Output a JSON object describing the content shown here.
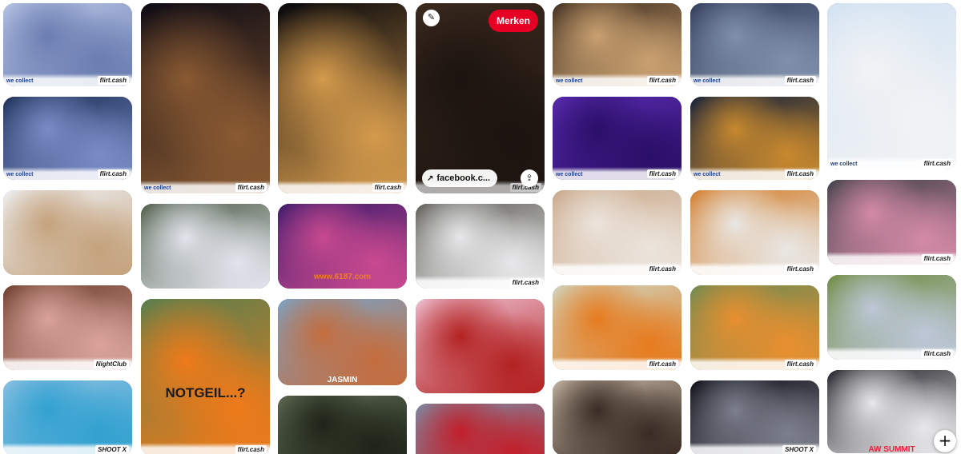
{
  "page": {
    "title": ""
  },
  "hover_actions": {
    "save_label": "Merken",
    "link_label": "facebook.c...",
    "link_arrow": "↗",
    "edit_icon": "pencil-icon",
    "share_icon": "share-icon"
  },
  "fab": {
    "label": "+",
    "icon": "plus-icon"
  },
  "watermarks": {
    "flirt": "flirt.cash",
    "collect": "we collect",
    "nightclub": "NightClub",
    "shoot": "SHOOT X"
  },
  "columns": [
    {
      "pins": [
        {
          "name": "pin-expo-booth",
          "h": 104,
          "bg": [
            "#b9c6e6",
            "#6b7db1"
          ],
          "wm": "flirt",
          "left": "collect"
        },
        {
          "name": "pin-party-group",
          "h": 104,
          "bg": [
            "#1b2e55",
            "#7a8cc6"
          ],
          "wm": "flirt",
          "left": "collect"
        },
        {
          "name": "pin-table-friends",
          "h": 106,
          "bg": [
            "#f0f3f7",
            "#c4a27c"
          ],
          "wm": ""
        },
        {
          "name": "pin-two-women",
          "h": 106,
          "bg": [
            "#6b3b2c",
            "#d9a39a"
          ],
          "wm": "nightclub"
        },
        {
          "name": "pin-pool-resort",
          "h": 94,
          "bg": [
            "#8dc0e2",
            "#31a1d0"
          ],
          "wm": "shoot"
        }
      ]
    },
    {
      "pins": [
        {
          "name": "pin-powder-tower",
          "h": 238,
          "bg": [
            "#0d0b14",
            "#8a5a32"
          ],
          "wm": "flirt",
          "left": "collect"
        },
        {
          "name": "pin-outdoor-table",
          "h": 106,
          "bg": [
            "#4b5a44",
            "#e2e4ec"
          ],
          "wm": ""
        },
        {
          "name": "pin-orange-shirt-man",
          "h": 196,
          "bg": [
            "#5b7f4d",
            "#ef7a19"
          ],
          "wm": "flirt",
          "label": "NOTGEIL...?",
          "label_color": "#1a1a1a",
          "label_top": 108
        }
      ]
    },
    {
      "pins": [
        {
          "name": "pin-tyn-church",
          "h": 238,
          "bg": [
            "#08080c",
            "#d49a4c"
          ],
          "wm": "flirt"
        },
        {
          "name": "pin-stage-show",
          "h": 106,
          "bg": [
            "#3a1a6b",
            "#c8498f"
          ],
          "wm": "",
          "label": "www.6187.com",
          "label_color": "#f07c2a",
          "label_top": 86
        },
        {
          "name": "pin-pool-party",
          "h": 108,
          "bg": [
            "#7aa4c9",
            "#c46d3e"
          ],
          "wm": "jasmin",
          "label": "JASMIN",
          "label_color": "#ffffff",
          "label_top": 96
        },
        {
          "name": "pin-go-karts",
          "h": 90,
          "bg": [
            "#5f6a52",
            "#1e2418"
          ],
          "wm": ""
        }
      ]
    },
    {
      "pins": [
        {
          "name": "pin-show-hovered",
          "h": 238,
          "bg": [
            "#4a3526",
            "#241914"
          ],
          "wm": "flirt",
          "hovered": true
        },
        {
          "name": "pin-cafe-terrace",
          "h": 106,
          "bg": [
            "#5c5b55",
            "#e8e8ea"
          ],
          "wm": "flirt"
        },
        {
          "name": "pin-red-jackets",
          "h": 118,
          "bg": [
            "#f0c4d6",
            "#b32222"
          ],
          "wm": ""
        },
        {
          "name": "pin-group-photo",
          "h": 90,
          "bg": [
            "#7a90a8",
            "#c21f2a"
          ],
          "wm": ""
        }
      ]
    },
    {
      "pins": [
        {
          "name": "pin-dancer-bar",
          "h": 104,
          "bg": [
            "#3d2d1e",
            "#c9a070"
          ],
          "wm": "flirt",
          "left": "collect"
        },
        {
          "name": "pin-aerial-act",
          "h": 104,
          "bg": [
            "#5a2bb0",
            "#2a0f68"
          ],
          "wm": "flirt",
          "left": "collect"
        },
        {
          "name": "pin-blonde-table",
          "h": 106,
          "bg": [
            "#c8a788",
            "#ece4dc"
          ],
          "wm": "flirt"
        },
        {
          "name": "pin-meeting-outside",
          "h": 106,
          "bg": [
            "#cfd8c5",
            "#e67b1e"
          ],
          "wm": "flirt"
        },
        {
          "name": "pin-tent-hall",
          "h": 94,
          "bg": [
            "#c9b9a8",
            "#3a2c24"
          ],
          "wm": ""
        }
      ]
    },
    {
      "pins": [
        {
          "name": "pin-conference",
          "h": 104,
          "bg": [
            "#2f3a58",
            "#8090aa"
          ],
          "wm": "flirt",
          "left": "collect"
        },
        {
          "name": "pin-charles-bridge",
          "h": 104,
          "bg": [
            "#0c1c3a",
            "#c8892e"
          ],
          "wm": "flirt",
          "left": "collect"
        },
        {
          "name": "pin-orange-group",
          "h": 106,
          "bg": [
            "#d27a24",
            "#e9e7e4"
          ],
          "wm": "flirt"
        },
        {
          "name": "pin-beer-garden",
          "h": 106,
          "bg": [
            "#6d8a52",
            "#e88f2f"
          ],
          "wm": "flirt"
        },
        {
          "name": "pin-sparklers",
          "h": 94,
          "bg": [
            "#0c0c14",
            "#7c7f8c"
          ],
          "wm": "shoot"
        }
      ]
    },
    {
      "pins": [
        {
          "name": "pin-booth-men",
          "h": 208,
          "bg": [
            "#d3e3f2",
            "#f2f3f5"
          ],
          "wm": "flirt",
          "left": "collect"
        },
        {
          "name": "pin-drinks-table",
          "h": 106,
          "bg": [
            "#3d3f46",
            "#d48aa7"
          ],
          "wm": "flirt"
        },
        {
          "name": "pin-terrace-group",
          "h": 106,
          "bg": [
            "#6c8a3c",
            "#bdc7d8"
          ],
          "wm": "flirt"
        },
        {
          "name": "pin-club-group",
          "h": 104,
          "bg": [
            "#1b1b22",
            "#e8e8ea"
          ],
          "wm": "summit",
          "label": "AW SUMMIT",
          "label_color": "#e8233b",
          "label_top": 94
        }
      ]
    }
  ],
  "colors": {
    "save_red": "#e60023",
    "collect_blue": "#1e3f8c"
  }
}
